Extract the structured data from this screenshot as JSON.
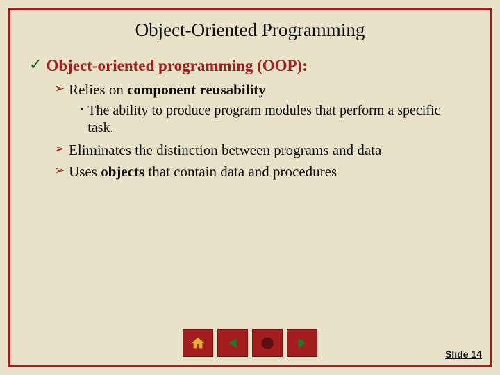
{
  "title": "Object-Oriented Programming",
  "bullets": {
    "l1": {
      "text": "Object-oriented programming (OOP):"
    },
    "l2_0_pre": "Relies on ",
    "l2_0_bold": "component reusability",
    "l3_0": "The ability to produce program modules that perform a specific task.",
    "l2_1": "Eliminates the distinction between programs and data",
    "l2_2_pre": "Uses ",
    "l2_2_bold": "objects",
    "l2_2_post": " that contain data and procedures"
  },
  "nav": {
    "home": "home-icon",
    "prev": "prev-icon",
    "stop": "stop-icon",
    "next": "next-icon"
  },
  "slide_number": "Slide 14"
}
